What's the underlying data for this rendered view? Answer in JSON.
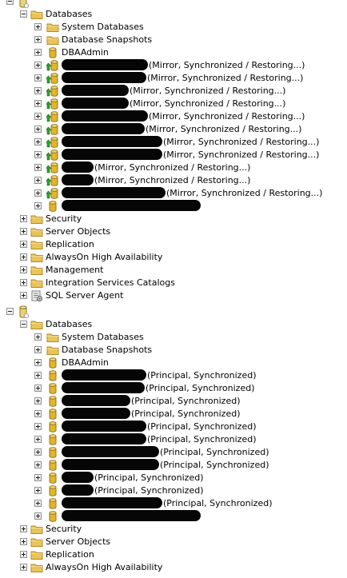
{
  "servers": [
    {
      "name": "",
      "folders": {
        "databases": "Databases",
        "system_databases": "System Databases",
        "database_snapshots": "Database Snapshots",
        "dbaadmin": "DBAAdmin"
      },
      "databases": [
        {
          "state": "(Mirror, Synchronized / Restoring...)",
          "icon": "mirror-db-icon"
        },
        {
          "state": "(Mirror, Synchronized / Restoring...)",
          "icon": "mirror-db-icon"
        },
        {
          "state": "(Mirror, Synchronized / Restoring...)",
          "icon": "mirror-db-icon"
        },
        {
          "state": "(Mirror, Synchronized / Restoring...)",
          "icon": "mirror-db-icon"
        },
        {
          "state": "(Mirror, Synchronized / Restoring...)",
          "icon": "mirror-db-icon"
        },
        {
          "state": "(Mirror, Synchronized / Restoring...)",
          "icon": "mirror-db-icon"
        },
        {
          "state": "(Mirror, Synchronized / Restoring...)",
          "icon": "mirror-db-icon"
        },
        {
          "state": "(Mirror, Synchronized / Restoring...)",
          "icon": "mirror-db-icon"
        },
        {
          "state": "(Mirror, Synchronized / Restoring...)",
          "icon": "mirror-db-icon"
        },
        {
          "state": "(Mirror, Synchronized / Restoring...)",
          "icon": "mirror-db-icon"
        },
        {
          "state": "(Mirror, Synchronized / Restoring...)",
          "icon": "mirror-db-icon"
        },
        {
          "state": "",
          "icon": "database-icon"
        }
      ],
      "nodes": [
        {
          "label": "Security",
          "icon": "folder-icon"
        },
        {
          "label": "Server Objects",
          "icon": "folder-icon"
        },
        {
          "label": "Replication",
          "icon": "folder-icon"
        },
        {
          "label": "AlwaysOn High Availability",
          "icon": "folder-icon"
        },
        {
          "label": "Management",
          "icon": "folder-icon"
        },
        {
          "label": "Integration Services Catalogs",
          "icon": "folder-icon"
        },
        {
          "label": "SQL Server Agent",
          "icon": "agent-icon"
        }
      ]
    },
    {
      "name": "",
      "folders": {
        "databases": "Databases",
        "system_databases": "System Databases",
        "database_snapshots": "Database Snapshots",
        "dbaadmin": "DBAAdmin"
      },
      "databases": [
        {
          "state": "(Principal, Synchronized)",
          "icon": "database-icon"
        },
        {
          "state": "(Principal, Synchronized)",
          "icon": "database-icon"
        },
        {
          "state": "(Principal, Synchronized)",
          "icon": "database-icon"
        },
        {
          "state": "(Principal, Synchronized)",
          "icon": "database-icon"
        },
        {
          "state": "(Principal, Synchronized)",
          "icon": "database-icon"
        },
        {
          "state": "(Principal, Synchronized)",
          "icon": "database-icon"
        },
        {
          "state": "(Principal, Synchronized)",
          "icon": "database-icon"
        },
        {
          "state": "(Principal, Synchronized)",
          "icon": "database-icon"
        },
        {
          "state": "(Principal, Synchronized)",
          "icon": "database-icon"
        },
        {
          "state": "(Principal, Synchronized)",
          "icon": "database-icon"
        },
        {
          "state": "(Principal, Synchronized)",
          "icon": "database-icon"
        },
        {
          "state": "",
          "icon": "database-icon"
        }
      ],
      "nodes": [
        {
          "label": "Security",
          "icon": "folder-icon"
        },
        {
          "label": "Server Objects",
          "icon": "folder-icon"
        },
        {
          "label": "Replication",
          "icon": "folder-icon"
        },
        {
          "label": "AlwaysOn High Availability",
          "icon": "folder-icon"
        }
      ]
    }
  ],
  "colors": {
    "folder": "#e8c45a",
    "folder_edge": "#b48a26",
    "database": "#e0b52f",
    "database_edge": "#9a7414",
    "mirror_arrow": "#2e9e2e",
    "redaction": "#060606"
  }
}
